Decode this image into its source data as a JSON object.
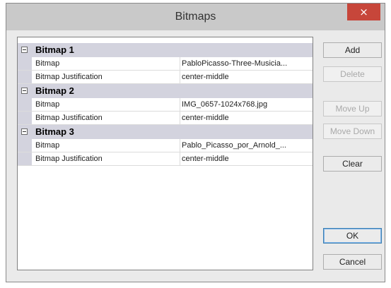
{
  "window": {
    "title": "Bitmaps",
    "close_icon": "×"
  },
  "grid": {
    "categories": [
      {
        "title": "Bitmap 1",
        "props": [
          {
            "name": "Bitmap",
            "value": "PabloPicasso-Three-Musicia..."
          },
          {
            "name": "Bitmap Justification",
            "value": "center-middle"
          }
        ]
      },
      {
        "title": "Bitmap 2",
        "props": [
          {
            "name": "Bitmap",
            "value": "IMG_0657-1024x768.jpg"
          },
          {
            "name": "Bitmap Justification",
            "value": "center-middle"
          }
        ]
      },
      {
        "title": "Bitmap 3",
        "props": [
          {
            "name": "Bitmap",
            "value": "Pablo_Picasso_por_Arnold_..."
          },
          {
            "name": "Bitmap Justification",
            "value": "center-middle"
          }
        ]
      }
    ]
  },
  "buttons": {
    "add": "Add",
    "delete": "Delete",
    "move_up": "Move Up",
    "move_down": "Move Down",
    "clear": "Clear",
    "ok": "OK",
    "cancel": "Cancel"
  }
}
